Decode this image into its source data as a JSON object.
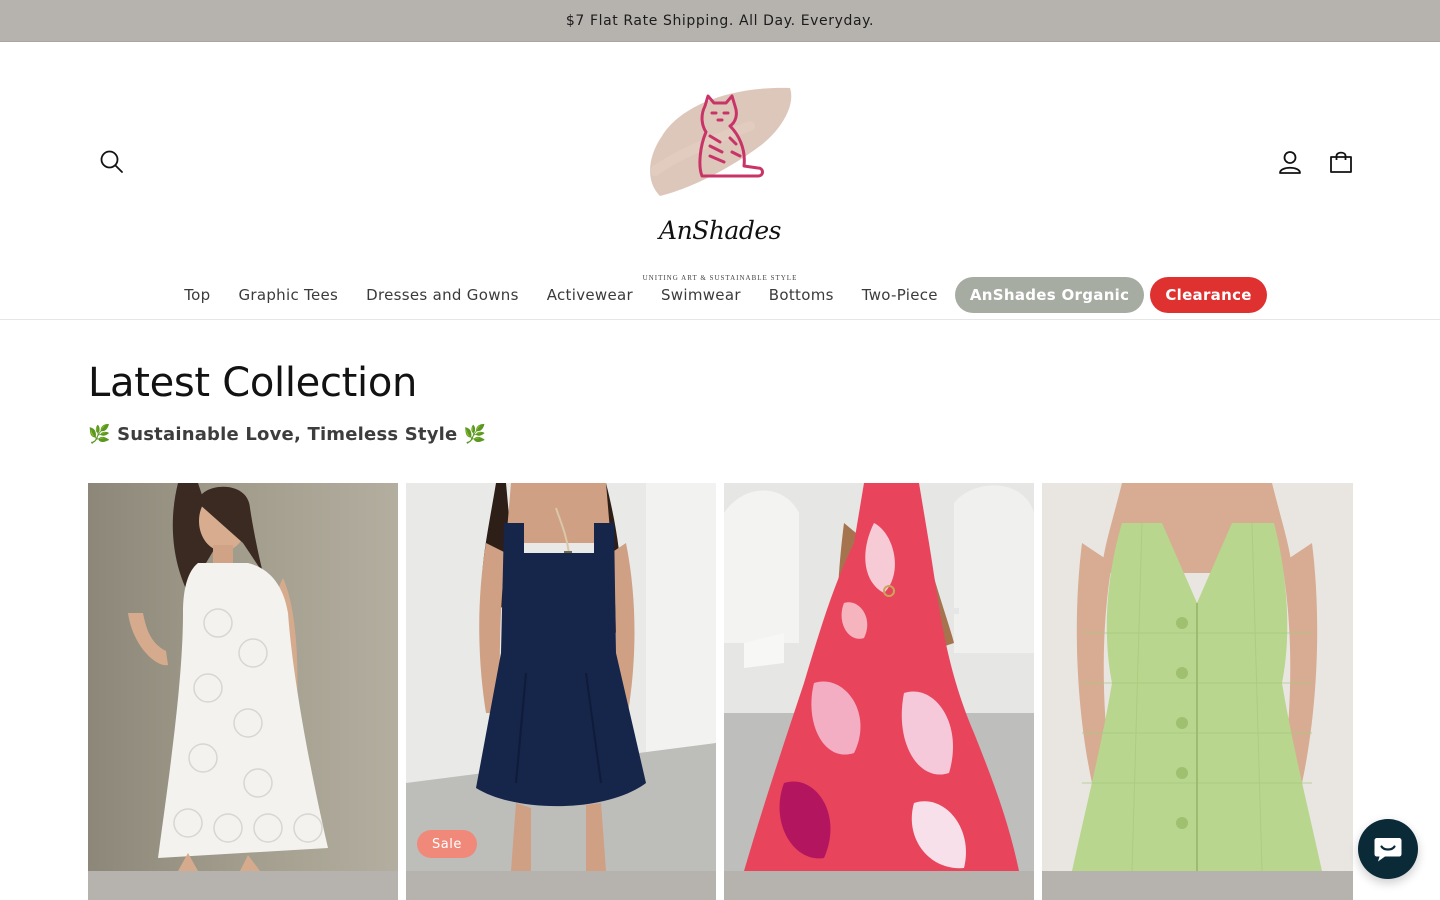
{
  "announcement": {
    "text": "$7 Flat Rate Shipping. All Day. Everyday."
  },
  "header": {
    "search_icon": "search-icon",
    "account_icon": "user-icon",
    "cart_icon": "cart-icon",
    "logo": {
      "brand": "AnShades",
      "tagline": "UNITING ART & SUSTAINABLE STYLE"
    }
  },
  "nav": {
    "items": [
      {
        "label": "Top"
      },
      {
        "label": "Graphic Tees"
      },
      {
        "label": "Dresses and Gowns"
      },
      {
        "label": "Activewear"
      },
      {
        "label": "Swimwear"
      },
      {
        "label": "Bottoms"
      },
      {
        "label": "Two-Piece"
      }
    ],
    "pills": [
      {
        "label": "AnShades Organic",
        "color": "#a7aca3"
      },
      {
        "label": "Clearance",
        "color": "#e03131"
      }
    ]
  },
  "collection": {
    "title": "Latest Collection",
    "subtitle": "🌿 Sustainable Love, Timeless Style 🌿"
  },
  "products": [
    {
      "badge": ""
    },
    {
      "badge": "Sale"
    },
    {
      "badge": ""
    },
    {
      "badge": ""
    }
  ],
  "colors": {
    "announcement_bg": "#b6b3af",
    "pill_organic": "#a7aca3",
    "pill_clearance": "#e03131",
    "sale_badge": "#f0897a",
    "chat_button": "#0b2a37"
  },
  "chat": {
    "icon": "chat-icon"
  }
}
